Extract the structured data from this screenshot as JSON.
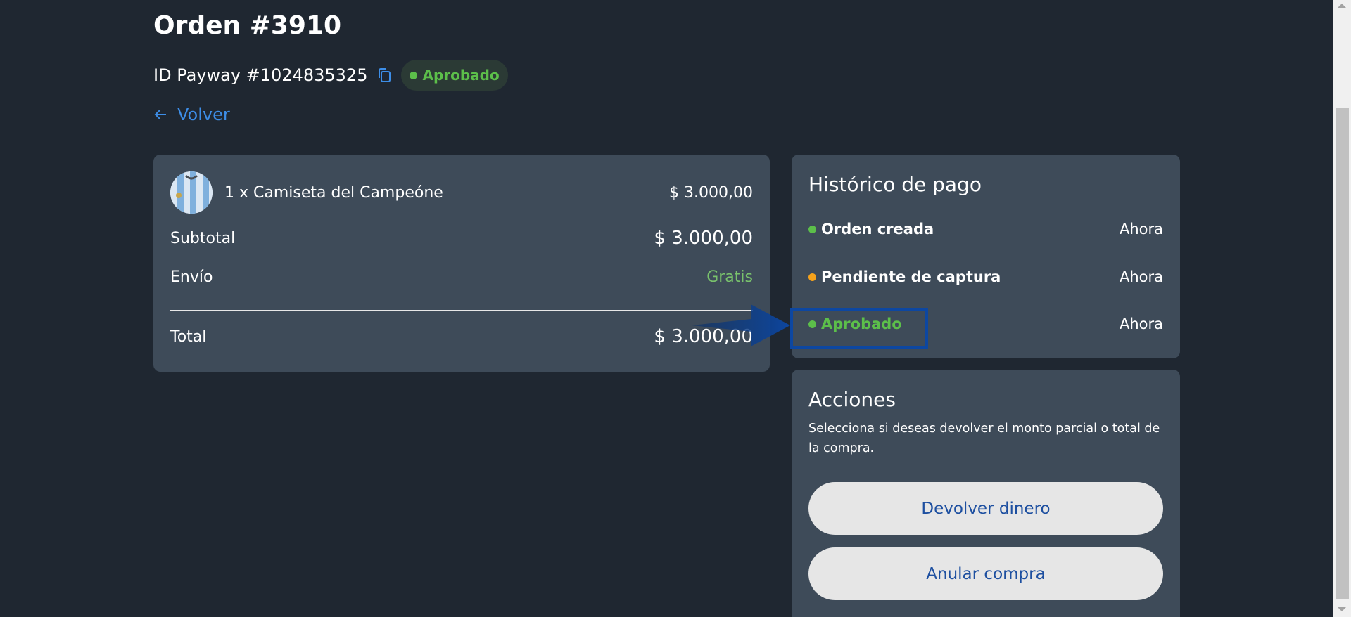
{
  "order": {
    "title": "Orden #3910",
    "payway_id": "ID Payway #1024835325",
    "status_badge": "Aprobado",
    "back_label": "Volver"
  },
  "items": {
    "product": {
      "label": "1 x Camiseta del Campeóne",
      "price": "$ 3.000,00"
    },
    "subtotal": {
      "label": "Subtotal",
      "value": "$ 3.000,00"
    },
    "shipping": {
      "label": "Envío",
      "value": "Gratis"
    },
    "total": {
      "label": "Total",
      "value": "$ 3.000,00"
    }
  },
  "history": {
    "title": "Histórico de pago",
    "events": [
      {
        "label": "Orden creada",
        "time": "Ahora",
        "dot_color": "#5cbf4a"
      },
      {
        "label": "Pendiente de captura",
        "time": "Ahora",
        "dot_color": "#f5a21b"
      },
      {
        "label": "Aprobado",
        "time": "Ahora",
        "dot_color": "#5cbf4a",
        "highlighted": true
      }
    ]
  },
  "actions": {
    "title": "Acciones",
    "description": "Selecciona si deseas devolver el monto parcial o total de la compra.",
    "refund_button": "Devolver dinero",
    "cancel_button": "Anular compra"
  },
  "icons": {
    "copy": "copy-icon",
    "back": "arrow-left-icon",
    "product_thumbnail": "jersey-thumbnail",
    "annotation": "annotation-arrow-icon"
  },
  "colors": {
    "background": "#1f2731",
    "card": "#3e4b59",
    "accent_link": "#3d8ee8",
    "status_approved": "#5cbf4a",
    "status_pending": "#f5a21b",
    "button_text": "#1d4fa0",
    "button_bg": "#e6e6e6",
    "annotation": "#0d47a1"
  }
}
